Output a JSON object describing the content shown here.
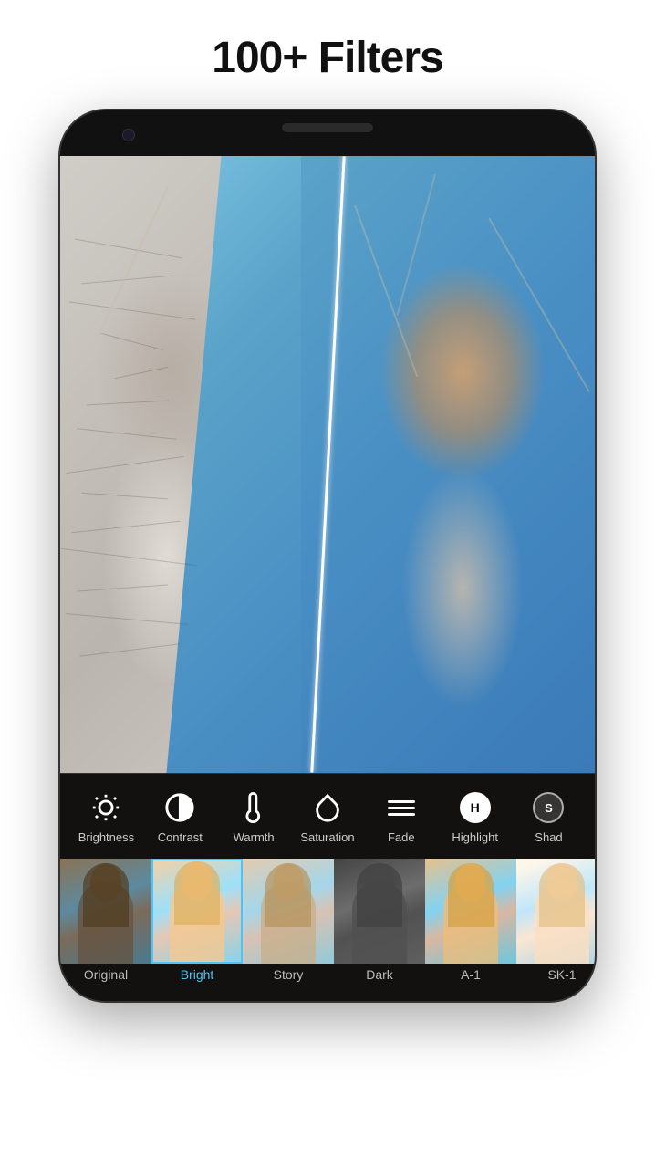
{
  "header": {
    "title": "100+ Filters"
  },
  "toolbar": {
    "tools": [
      {
        "id": "brightness",
        "label": "Brightness",
        "icon": "sun"
      },
      {
        "id": "contrast",
        "label": "Contrast",
        "icon": "contrast"
      },
      {
        "id": "warmth",
        "label": "Warmth",
        "icon": "thermometer"
      },
      {
        "id": "saturation",
        "label": "Saturation",
        "icon": "drop"
      },
      {
        "id": "fade",
        "label": "Fade",
        "icon": "lines"
      },
      {
        "id": "highlight",
        "label": "Highlight",
        "icon": "H"
      },
      {
        "id": "shadow",
        "label": "Shad",
        "icon": "S"
      }
    ]
  },
  "filters": [
    {
      "id": "original",
      "label": "Original",
      "selected": false
    },
    {
      "id": "bright",
      "label": "Bright",
      "selected": true
    },
    {
      "id": "story",
      "label": "Story",
      "selected": false
    },
    {
      "id": "dark",
      "label": "Dark",
      "selected": false
    },
    {
      "id": "a1",
      "label": "A-1",
      "selected": false
    },
    {
      "id": "sk1",
      "label": "SK-1",
      "selected": false
    }
  ]
}
